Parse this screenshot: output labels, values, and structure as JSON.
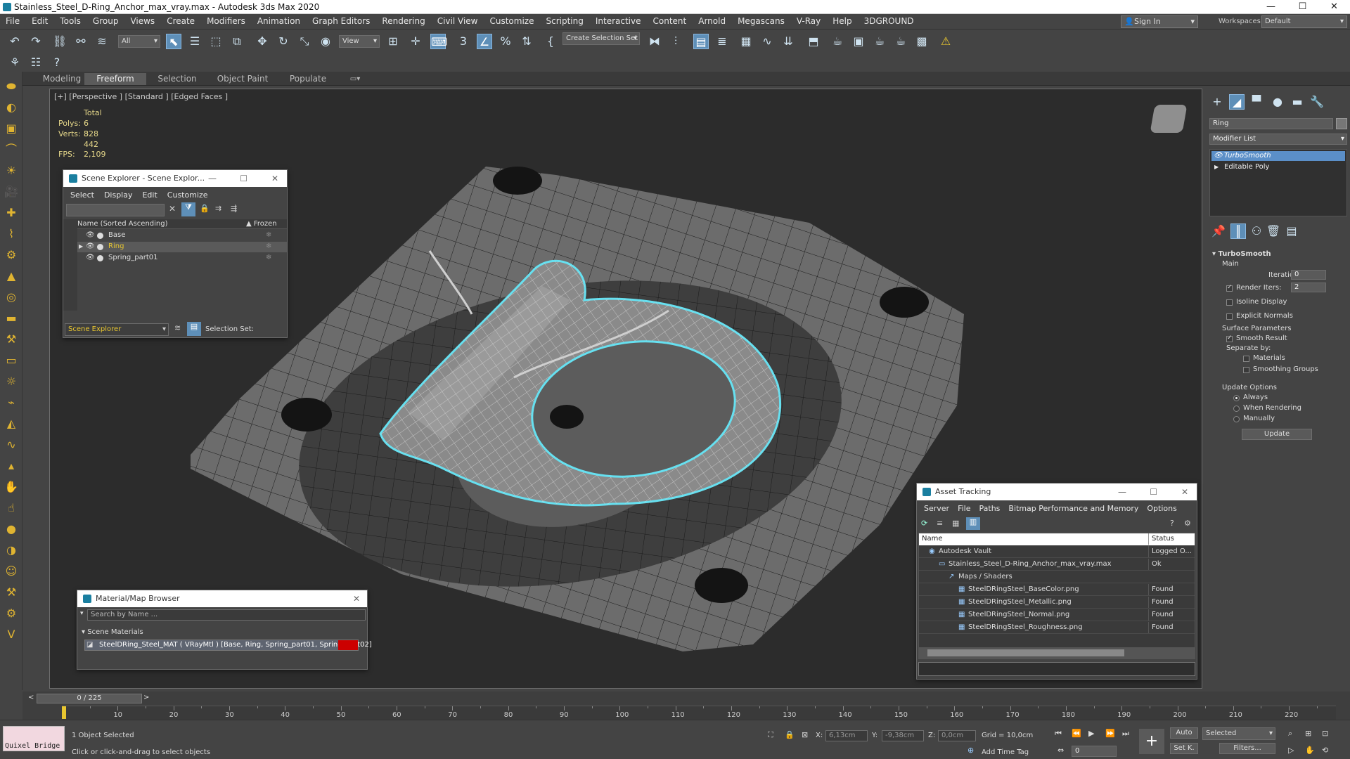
{
  "window": {
    "title": "Stainless_Steel_D-Ring_Anchor_max_vray.max - Autodesk 3ds Max 2020",
    "minimize": "—",
    "maximize": "☐",
    "close": "✕"
  },
  "menu": [
    "File",
    "Edit",
    "Tools",
    "Group",
    "Views",
    "Create",
    "Modifiers",
    "Animation",
    "Graph Editors",
    "Rendering",
    "Civil View",
    "Customize",
    "Scripting",
    "Interactive",
    "Content",
    "Arnold",
    "Megascans",
    "V-Ray",
    "Help",
    "3DGROUND"
  ],
  "signin": "Sign In",
  "workspaces_label": "Workspaces:",
  "workspace": "Default",
  "toolbar": {
    "filter": "All",
    "view": "View",
    "selection_set": "Create Selection Set"
  },
  "ribbon_tabs": [
    "Modeling",
    "Freeform",
    "Selection",
    "Object Paint",
    "Populate"
  ],
  "viewport": {
    "label": "[+] [Perspective ] [Standard ] [Edged Faces ]",
    "stats": {
      "total": "Total",
      "polys_label": "Polys:",
      "polys": "6 828",
      "verts_label": "Verts:",
      "verts": "3 442",
      "fps_label": "FPS:",
      "fps": "2,109"
    }
  },
  "scene_explorer": {
    "title": "Scene Explorer - Scene Explor...",
    "menu": [
      "Select",
      "Display",
      "Edit",
      "Customize"
    ],
    "col_name": "Name (Sorted Ascending)",
    "col_frozen": "▲ Frozen",
    "items": [
      "Base",
      "Ring",
      "Spring_part01"
    ],
    "footer_dropdown": "Scene Explorer",
    "selection_set": "Selection Set:"
  },
  "material_browser": {
    "title": "Material/Map Browser",
    "search": "Search by Name ...",
    "group": "Scene Materials",
    "material": "SteelDRing_Steel_MAT  ( VRayMtl )  [Base, Ring, Spring_part01, Spring_part02]"
  },
  "asset_tracking": {
    "title": "Asset Tracking",
    "menu": [
      "Server",
      "File",
      "Paths",
      "Bitmap Performance and Memory",
      "Options"
    ],
    "col_name": "Name",
    "col_status": "Status",
    "rows": [
      {
        "name": "Autodesk Vault",
        "status": "Logged O..."
      },
      {
        "name": "Stainless_Steel_D-Ring_Anchor_max_vray.max",
        "status": "Ok"
      },
      {
        "name": "Maps / Shaders",
        "status": ""
      },
      {
        "name": "SteelDRingSteel_BaseColor.png",
        "status": "Found"
      },
      {
        "name": "SteelDRingSteel_Metallic.png",
        "status": "Found"
      },
      {
        "name": "SteelDRingSteel_Normal.png",
        "status": "Found"
      },
      {
        "name": "SteelDRingSteel_Roughness.png",
        "status": "Found"
      }
    ]
  },
  "command_panel": {
    "object_name": "Ring",
    "modifier_list": "Modifier List",
    "stack": [
      "TurboSmooth",
      "Editable Poly"
    ],
    "rollout": {
      "title": "TurboSmooth",
      "main": "Main",
      "iterations_label": "Iterations:",
      "iterations": "0",
      "render_iters_label": "Render Iters:",
      "render_iters": "2",
      "isoline": "Isoline Display",
      "explicit": "Explicit Normals",
      "surface": "Surface Parameters",
      "smooth": "Smooth Result",
      "separate": "Separate by:",
      "materials": "Materials",
      "smoothing": "Smoothing Groups",
      "update_options": "Update Options",
      "always": "Always",
      "when_rendering": "When Rendering",
      "manually": "Manually",
      "update": "Update"
    }
  },
  "timeline": {
    "slider": "0 / 225",
    "ticks": [
      "10",
      "20",
      "30",
      "40",
      "50",
      "60",
      "70",
      "80",
      "90",
      "100",
      "110",
      "120",
      "130",
      "140",
      "150",
      "160",
      "170",
      "180",
      "190",
      "200",
      "210",
      "220"
    ]
  },
  "status": {
    "quixel": "Quixel Bridge",
    "selected": "1 Object Selected",
    "hint": "Click or click-and-drag to select objects",
    "x_label": "X:",
    "x": "6,13cm",
    "y_label": "Y:",
    "y": "-9,38cm",
    "z_label": "Z:",
    "z": "0,0cm",
    "grid": "Grid = 10,0cm",
    "add_time_tag": "Add Time Tag",
    "auto": "Auto",
    "selected_dd": "Selected",
    "setk": "Set K.",
    "filters": "Filters...",
    "frame": "0"
  },
  "colors": {
    "selection": "#66e0f0",
    "accent": "#5e8fb8",
    "stats": "#e6d88a"
  }
}
